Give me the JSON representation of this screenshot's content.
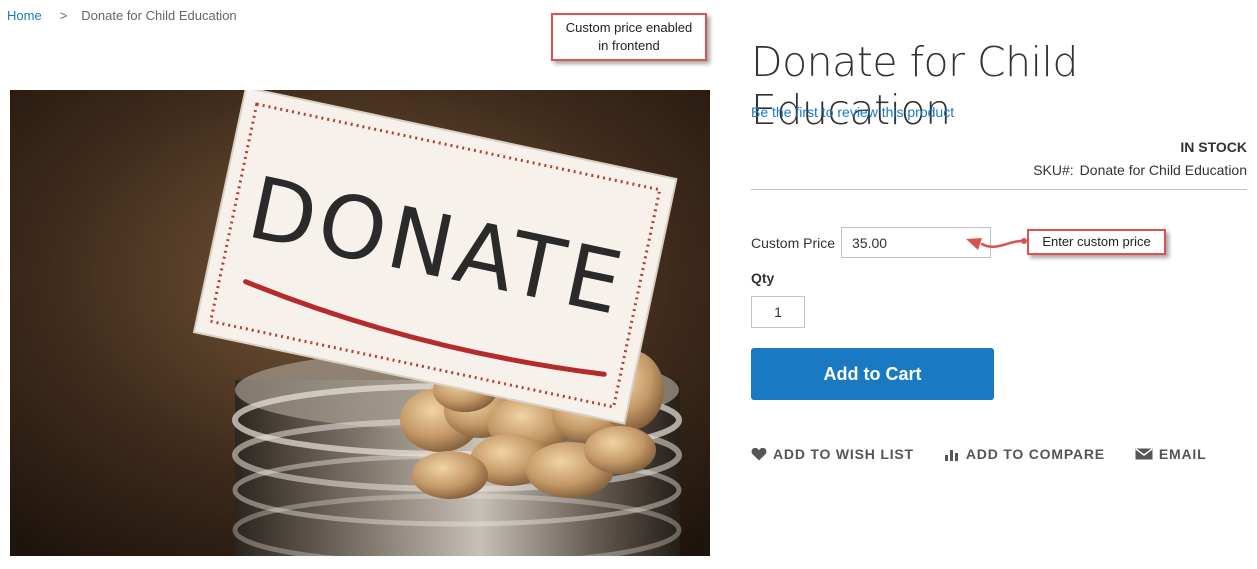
{
  "breadcrumb": {
    "home": "Home",
    "separator": ">",
    "current": "Donate for Child Education"
  },
  "annotations": {
    "frontend_note": [
      "Custom price enabled",
      "in frontend"
    ],
    "price_note": "Enter custom price"
  },
  "product": {
    "title": "Donate for Child Education",
    "review_link": "Be the first to review this product",
    "stock": "IN STOCK",
    "sku_label": "SKU#:",
    "sku_value": "Donate for Child Education",
    "image_text": "DONATE"
  },
  "form": {
    "custom_price_label": "Custom Price",
    "custom_price_value": "35.00",
    "qty_label": "Qty",
    "qty_value": "1",
    "add_to_cart": "Add to Cart"
  },
  "actions": {
    "wishlist": "ADD TO WISH LIST",
    "compare": "ADD TO COMPARE",
    "email": "EMAIL"
  },
  "icons": {
    "wishlist": "heart-icon",
    "compare": "bar-chart-icon",
    "email": "envelope-icon"
  },
  "colors": {
    "link": "#1979c3",
    "button": "#1979c3",
    "callout_border": "#d9534f"
  }
}
